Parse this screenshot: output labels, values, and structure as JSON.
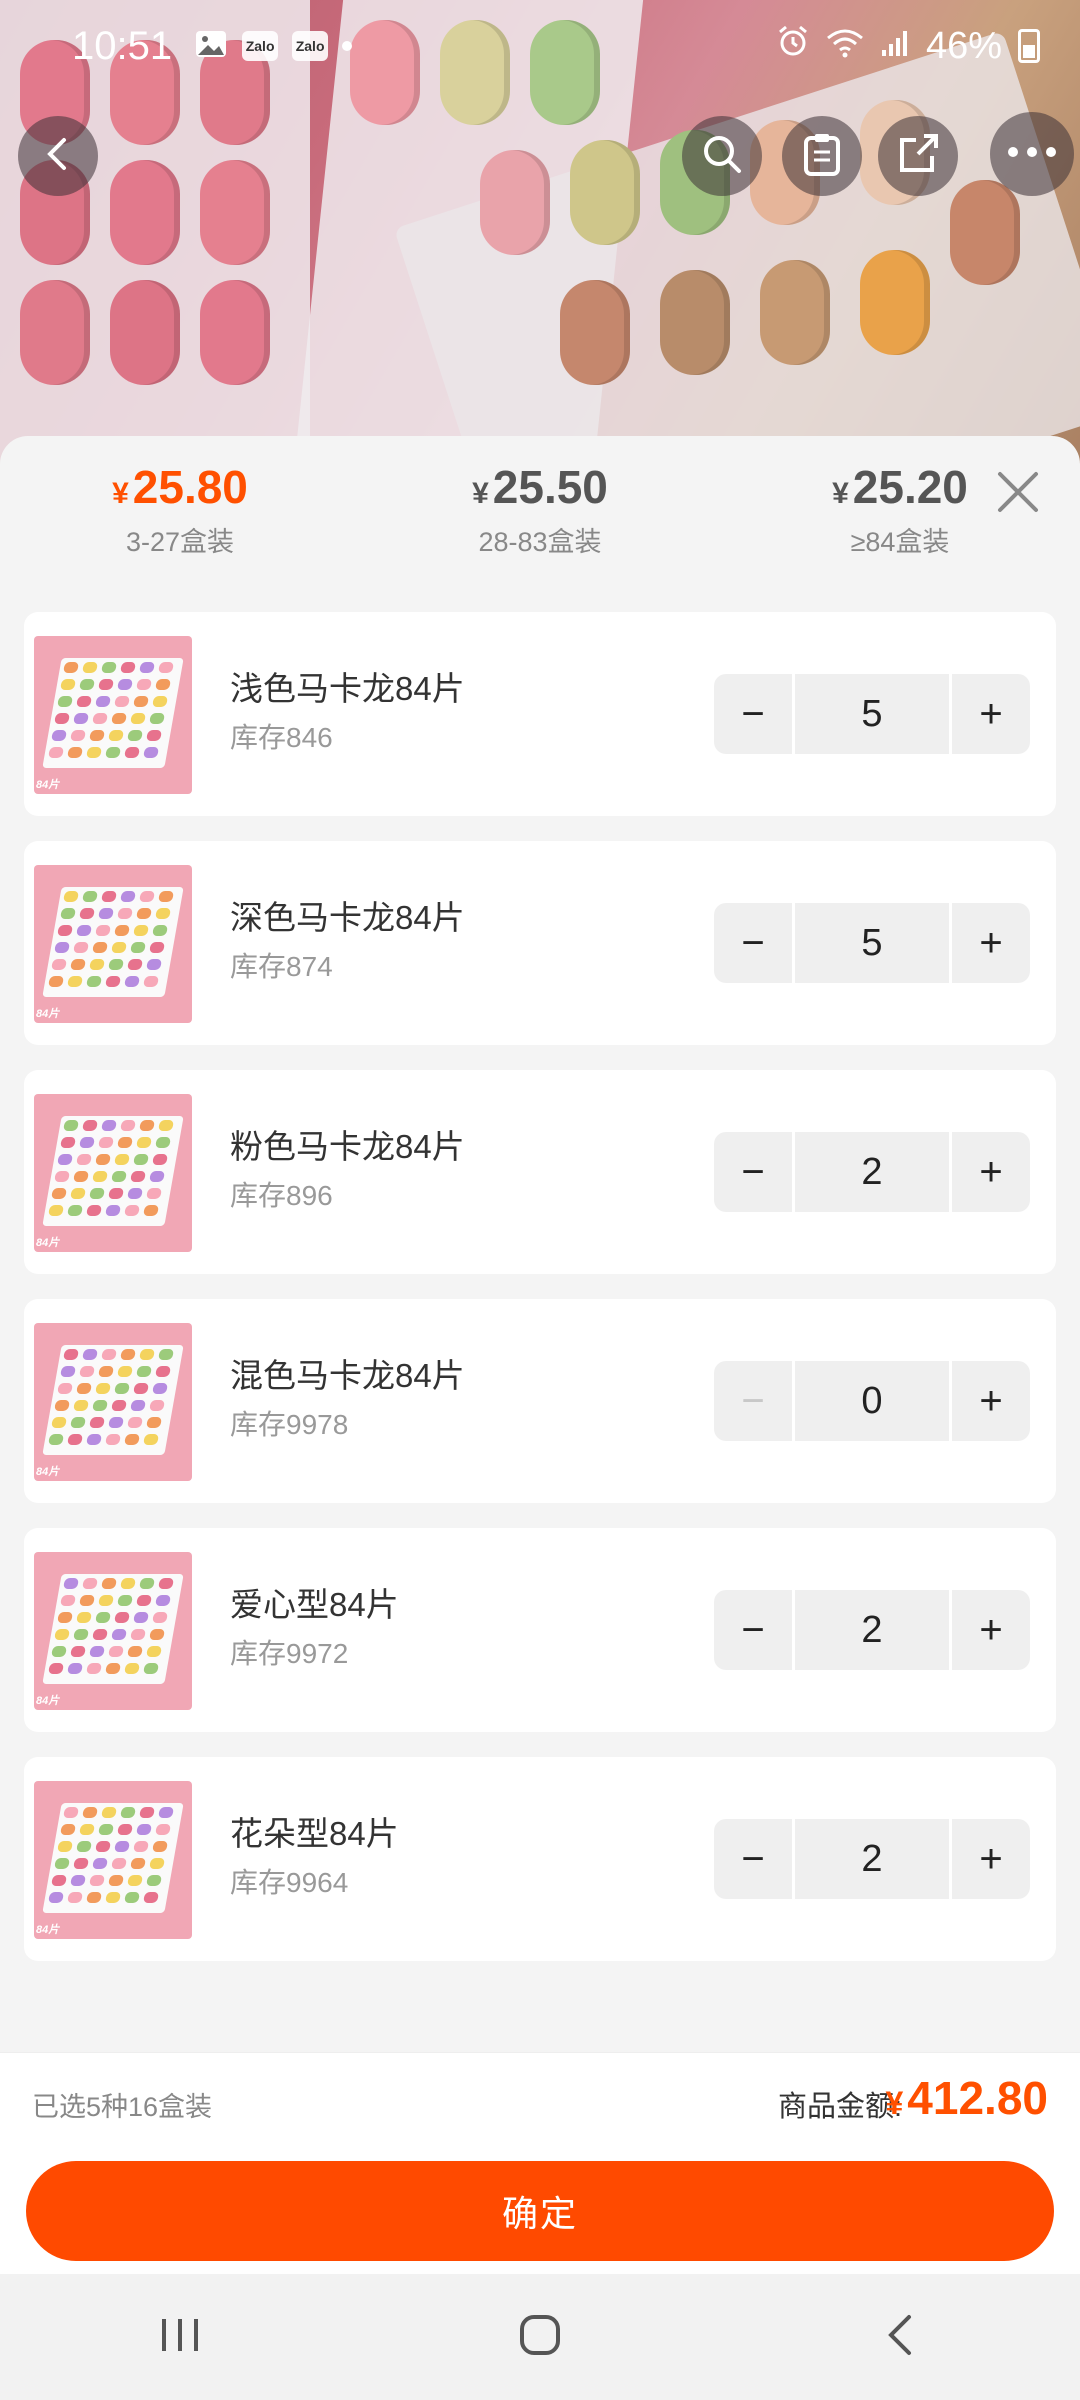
{
  "status_bar": {
    "time": "10:51",
    "notif_icons": [
      "image-icon",
      "zalo-icon",
      "zalo-icon"
    ],
    "zalo_label": "Zalo",
    "battery": "46%"
  },
  "header_actions": [
    "back-icon",
    "search-icon",
    "clipboard-icon",
    "share-icon",
    "more-icon"
  ],
  "price_tiers": [
    {
      "currency": "¥",
      "price": "25.80",
      "range": "3-27盒装",
      "active": true
    },
    {
      "currency": "¥",
      "price": "25.50",
      "range": "28-83盒装",
      "active": false
    },
    {
      "currency": "¥",
      "price": "25.20",
      "range": "≥84盒装",
      "active": false
    }
  ],
  "items": [
    {
      "name": "浅色马卡龙84片",
      "stock": "库存846",
      "qty": "5",
      "minus": "−",
      "plus": "+",
      "thumb_tag": "84片"
    },
    {
      "name": "深色马卡龙84片",
      "stock": "库存874",
      "qty": "5",
      "minus": "−",
      "plus": "+",
      "thumb_tag": "84片"
    },
    {
      "name": "粉色马卡龙84片",
      "stock": "库存896",
      "qty": "2",
      "minus": "−",
      "plus": "+",
      "thumb_tag": "84片"
    },
    {
      "name": "混色马卡龙84片",
      "stock": "库存9978",
      "qty": "0",
      "minus": "−",
      "plus": "+",
      "thumb_tag": "84片"
    },
    {
      "name": "爱心型84片",
      "stock": "库存9972",
      "qty": "2",
      "minus": "−",
      "plus": "+",
      "thumb_tag": "84片"
    },
    {
      "name": "花朵型84片",
      "stock": "库存9964",
      "qty": "2",
      "minus": "−",
      "plus": "+",
      "thumb_tag": "84片"
    }
  ],
  "footer": {
    "selected_summary": "已选5种16盒装",
    "amount_label": "商品金额:",
    "currency": "¥",
    "amount": "412.80",
    "confirm_label": "确定"
  },
  "colors": {
    "accent": "#ff5000",
    "confirm_bg": "#ff4a00"
  }
}
